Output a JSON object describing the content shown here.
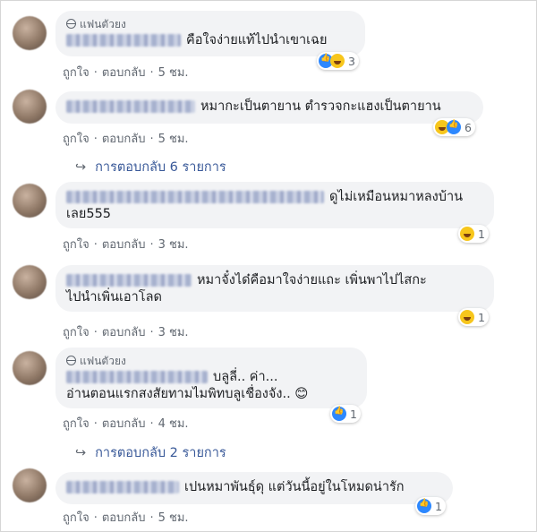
{
  "comments": [
    {
      "fan_label": "แฟนตัวยง",
      "text": "คือใจง่ายแท้ไปนำเขาเฉย",
      "like": "ถูกใจ",
      "reply": "ตอบกลับ",
      "time": "5 ชม.",
      "count": "3"
    },
    {
      "text": "หมากะเป็นตายาน ตำรวจกะแฮงเป็นตายาน",
      "like": "ถูกใจ",
      "reply": "ตอบกลับ",
      "time": "5 ชม.",
      "count": "6",
      "replies": "การตอบกลับ 6 รายการ"
    },
    {
      "text1": "ดูไม่เหมือนหมาหลงบ้าน",
      "text2": "เลย555",
      "like": "ถูกใจ",
      "reply": "ตอบกลับ",
      "time": "3 ชม.",
      "count": "1"
    },
    {
      "text1": "หมาจั๋งได๋คือมาใจง่ายแถะ เพิ่นพาไปไสกะ",
      "text2": "ไปนำเพิ่นเอาโลด",
      "like": "ถูกใจ",
      "reply": "ตอบกลับ",
      "time": "3 ชม.",
      "count": "1"
    },
    {
      "fan_label": "แฟนตัวยง",
      "text1": "บลูลี่.. ค่า...",
      "text2": "อ่านตอนแรกสงสัยทามไมพิทบลูเชื่องจัง.. 😊",
      "like": "ถูกใจ",
      "reply": "ตอบกลับ",
      "time": "4 ชม.",
      "count": "1",
      "replies": "การตอบกลับ 2 รายการ"
    },
    {
      "text": "เปนหมาพันธุ์ดุ แต่วันนี้อยู่ในโหมดน่ารัก",
      "like": "ถูกใจ",
      "reply": "ตอบกลับ",
      "time": "5 ชม.",
      "count": "1"
    }
  ],
  "colors": {
    "bubble": "#f2f3f5",
    "link": "#385898",
    "meta": "#606770"
  }
}
